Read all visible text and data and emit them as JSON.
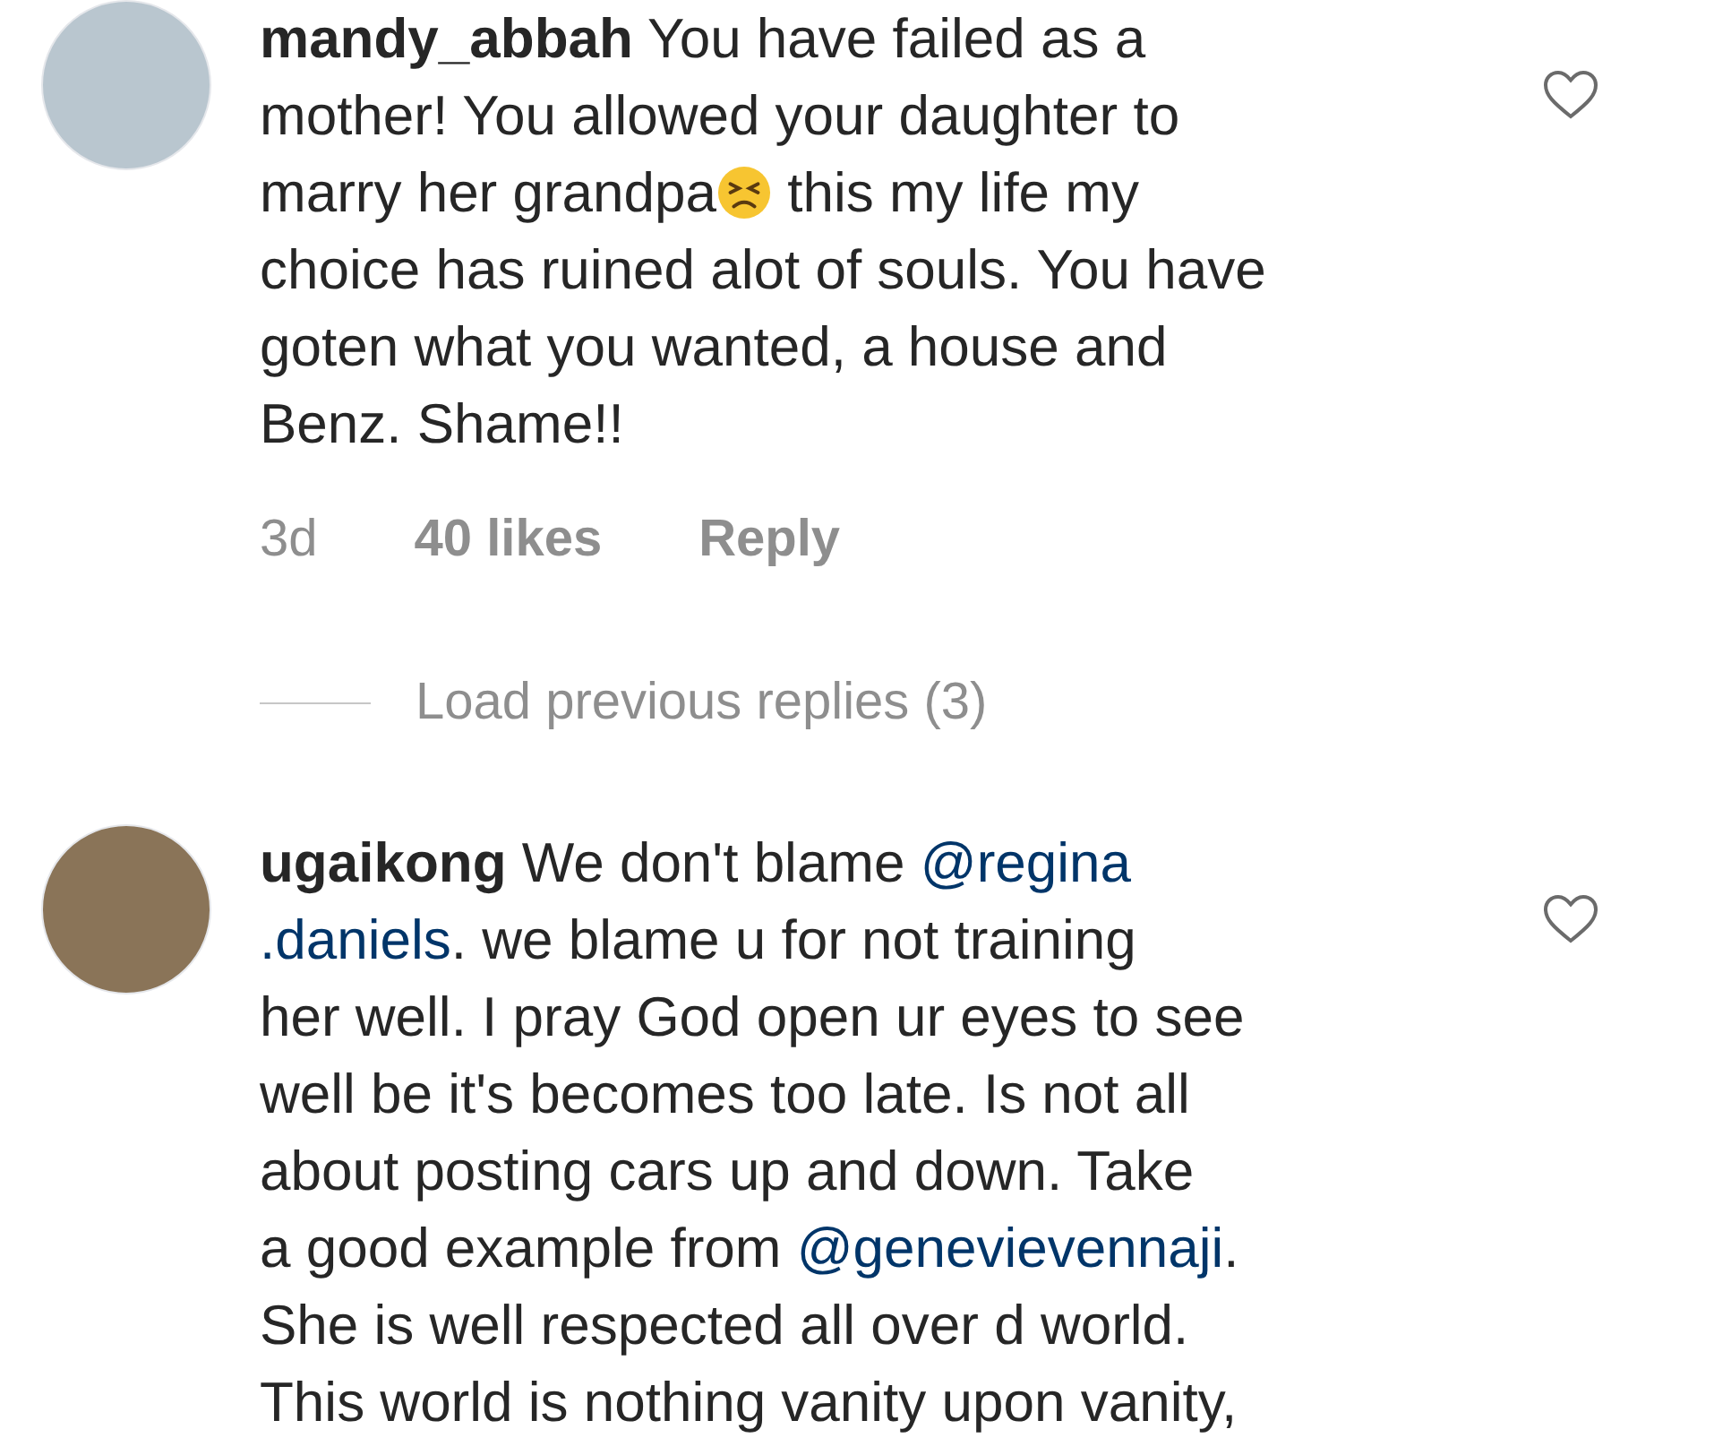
{
  "comments": [
    {
      "username": "mandy_abbah",
      "lines": [
        [
          {
            "kind": "text",
            "text": "You have failed as a"
          }
        ],
        [
          {
            "kind": "text",
            "text": "mother! You allowed your daughter to"
          }
        ],
        [
          {
            "kind": "text",
            "text": "marry her grandpa"
          },
          {
            "kind": "emoji"
          },
          {
            "kind": "text",
            "text": " this my life my"
          }
        ],
        [
          {
            "kind": "text",
            "text": "choice has ruined alot of souls. You have"
          }
        ],
        [
          {
            "kind": "text",
            "text": "goten what you wanted, a house and"
          }
        ],
        [
          {
            "kind": "text",
            "text": "Benz. Shame!!"
          }
        ]
      ],
      "time": "3d",
      "likes": "40 likes",
      "reply": "Reply",
      "load_replies": "Load previous replies (3)"
    },
    {
      "username": "ugaikong",
      "lines": [
        [
          {
            "kind": "text",
            "text": "We don't blame "
          },
          {
            "kind": "mention",
            "text": "@regina"
          }
        ],
        [
          {
            "kind": "mention",
            "text": ".daniels"
          },
          {
            "kind": "text",
            "text": ". we blame u for not training"
          }
        ],
        [
          {
            "kind": "text",
            "text": "her well. I pray God open ur eyes to see"
          }
        ],
        [
          {
            "kind": "text",
            "text": "well be it's becomes too late. Is not all"
          }
        ],
        [
          {
            "kind": "text",
            "text": "about posting cars up and down. Take"
          }
        ],
        [
          {
            "kind": "text",
            "text": "a good example from "
          },
          {
            "kind": "mention",
            "text": "@genevievennaji"
          },
          {
            "kind": "text",
            "text": "."
          }
        ],
        [
          {
            "kind": "text",
            "text": "She is well respected all over d world."
          }
        ],
        [
          {
            "kind": "text",
            "text": "This world is nothing vanity upon vanity,"
          }
        ]
      ]
    }
  ]
}
